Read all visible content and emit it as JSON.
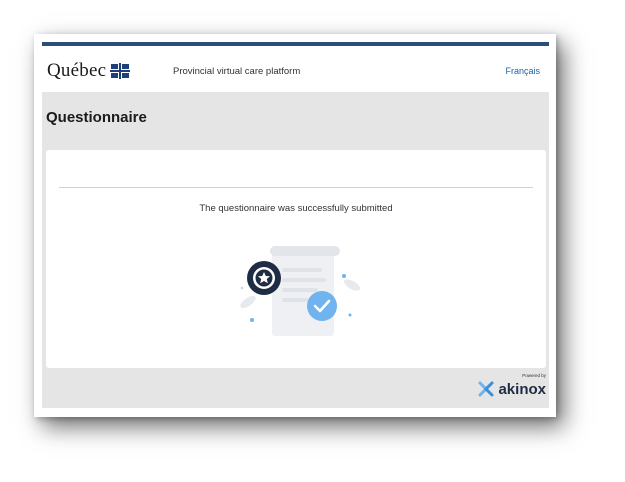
{
  "header": {
    "logo_text": "Québec",
    "platform_name": "Provincial virtual care platform",
    "language_link": "Français"
  },
  "page": {
    "title": "Questionnaire"
  },
  "card": {
    "message": "The questionnaire was successfully submitted"
  },
  "footer": {
    "powered_by": "Powered by",
    "brand": "akinox"
  },
  "colors": {
    "top_bar": "#2b4e78",
    "link": "#1a62a8",
    "check_badge": "#6fb3ef",
    "seal": "#1f2d44"
  },
  "icons": [
    "quebec-fleur-de-lis-icon",
    "award-seal-icon",
    "check-circle-icon",
    "akinox-logo-icon"
  ]
}
